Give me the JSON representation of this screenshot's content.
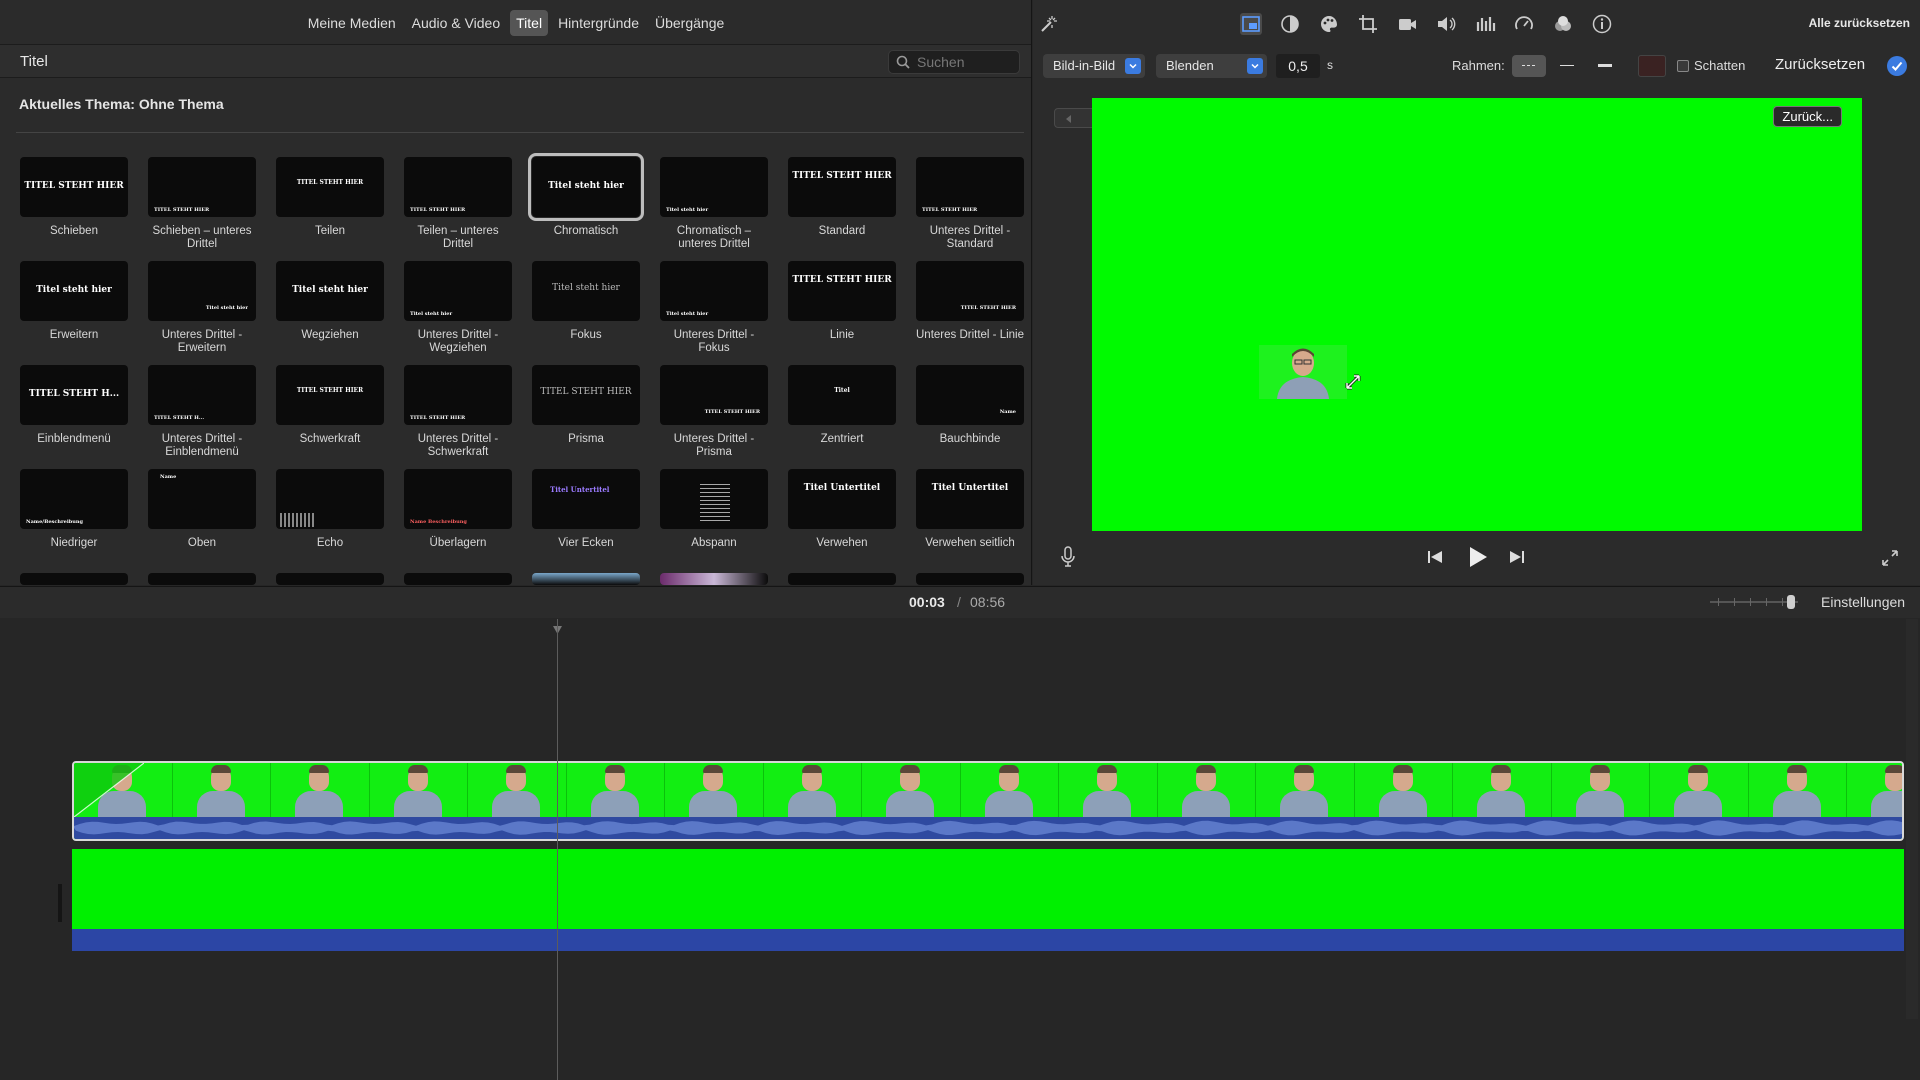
{
  "browser": {
    "tabs": [
      {
        "label": "Meine Medien",
        "active": false
      },
      {
        "label": "Audio & Video",
        "active": false
      },
      {
        "label": "Titel",
        "active": true
      },
      {
        "label": "Hintergründe",
        "active": false
      },
      {
        "label": "Übergänge",
        "active": false
      }
    ],
    "header_title": "Titel",
    "search_placeholder": "Suchen",
    "theme_label": "Aktuelles Thema: Ohne Thema",
    "titles": [
      {
        "name": "Schieben",
        "preview": "TITEL STEHT HIER",
        "style": "mid"
      },
      {
        "name": "Schieben – unteres Drittel",
        "preview": "TITEL STEHT HIER",
        "style": "low"
      },
      {
        "name": "Teilen",
        "preview": "TITEL STEHT HIER",
        "style": "small"
      },
      {
        "name": "Teilen – unteres Drittel",
        "preview": "TITEL STEHT HIER",
        "style": "low"
      },
      {
        "name": "Chromatisch",
        "preview": "Titel steht hier",
        "style": "mid",
        "selected": true
      },
      {
        "name": "Chromatisch – unteres Drittel",
        "preview": "Titel steht hier",
        "style": "low"
      },
      {
        "name": "Standard",
        "preview": "TITEL STEHT HIER",
        "style": "twoline"
      },
      {
        "name": "Unteres Drittel - Standard",
        "preview": "TITEL STEHT HIER",
        "style": "low"
      },
      {
        "name": "Erweitern",
        "preview": "Titel steht hier",
        "style": "mid"
      },
      {
        "name": "Unteres Drittel - Erweitern",
        "preview": "Titel steht hier",
        "style": "right"
      },
      {
        "name": "Wegziehen",
        "preview": "Titel steht hier",
        "style": "mid"
      },
      {
        "name": "Unteres Drittel - Wegziehen",
        "preview": "Titel steht hier",
        "style": "low"
      },
      {
        "name": "Fokus",
        "preview": "Titel steht hier",
        "style": "faint"
      },
      {
        "name": "Unteres Drittel - Fokus",
        "preview": "Titel steht hier",
        "style": "low"
      },
      {
        "name": "Linie",
        "preview": "TITEL STEHT HIER",
        "style": "twoline"
      },
      {
        "name": "Unteres Drittel - Linie",
        "preview": "TITEL STEHT HIER",
        "style": "right"
      },
      {
        "name": "Einblendmenü",
        "preview": "TITEL STEHT H...",
        "style": "mid"
      },
      {
        "name": "Unteres Drittel - Einblendmenü",
        "preview": "TITEL STEHT H...",
        "style": "low"
      },
      {
        "name": "Schwerkraft",
        "preview": "TITEL STEHT HIER",
        "style": "small"
      },
      {
        "name": "Unteres Drittel - Schwerkraft",
        "preview": "TITEL STEHT HIER",
        "style": "low"
      },
      {
        "name": "Prisma",
        "preview": "TITEL STEHT HIER",
        "style": "faint"
      },
      {
        "name": "Unteres Drittel - Prisma",
        "preview": "TITEL STEHT HIER",
        "style": "right"
      },
      {
        "name": "Zentriert",
        "preview": "Titel",
        "style": "small"
      },
      {
        "name": "Bauchbinde",
        "preview": "Name",
        "style": "right"
      },
      {
        "name": "Niedriger",
        "preview": "Name/Beschreibung",
        "style": "low"
      },
      {
        "name": "Oben",
        "preview": "Name",
        "style": "top"
      },
      {
        "name": "Echo",
        "preview": "",
        "style": "echo"
      },
      {
        "name": "Überlagern",
        "preview": "Name Beschreibung",
        "style": "red"
      },
      {
        "name": "Vier Ecken",
        "preview": "Titel Untertitel",
        "style": "violet"
      },
      {
        "name": "Abspann",
        "preview": "",
        "style": "lines"
      },
      {
        "name": "Verwehen",
        "preview": "Titel Untertitel",
        "style": "twoline"
      },
      {
        "name": "Verwehen seitlich",
        "preview": "Titel Untertitel",
        "style": "twoline"
      }
    ]
  },
  "viewer": {
    "toolbar_icons": [
      "magic-wand-icon",
      "overlay-icon",
      "color-balance-icon",
      "color-correction-icon",
      "crop-icon",
      "stabilization-icon",
      "volume-icon",
      "equalizer-icon",
      "speed-icon",
      "noise-reduction-icon",
      "info-icon"
    ],
    "reset_all": "Alle zurücksetzen",
    "overlay_mode": "Bild-in-Bild",
    "transition_mode": "Blenden",
    "duration": "0,5",
    "duration_unit": "s",
    "border_label": "Rahmen:",
    "shadow_label": "Schatten",
    "shadow_checked": false,
    "reset_label": "Zurücksetzen",
    "back_label": "Zurück...",
    "canvas_color": "#00fa00"
  },
  "timeline": {
    "current_time": "00:03",
    "separator": "/",
    "total_time": "08:56",
    "settings_label": "Einstellungen",
    "clip_color": "#00e600",
    "audio_color": "#2f4aa0"
  }
}
